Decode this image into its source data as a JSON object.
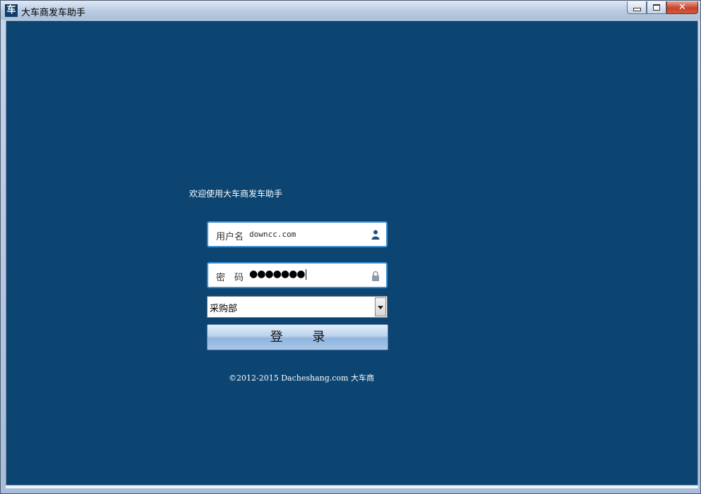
{
  "window": {
    "title": "大车商发车助手",
    "icon_char": "车"
  },
  "controls": {
    "close_label": "✕"
  },
  "login": {
    "welcome": "欢迎使用大车商发车助手",
    "username_label": "用户名",
    "username_value": "downcc.com",
    "password_label": "密　码",
    "password_mask": "●●●●●●●",
    "department_value": "采购部",
    "login_button": "登 录",
    "copyright": "©2012-2015 Dacheshang.com 大车商"
  },
  "colors": {
    "background": "#0c4572",
    "field_border": "#3d8fd0"
  }
}
